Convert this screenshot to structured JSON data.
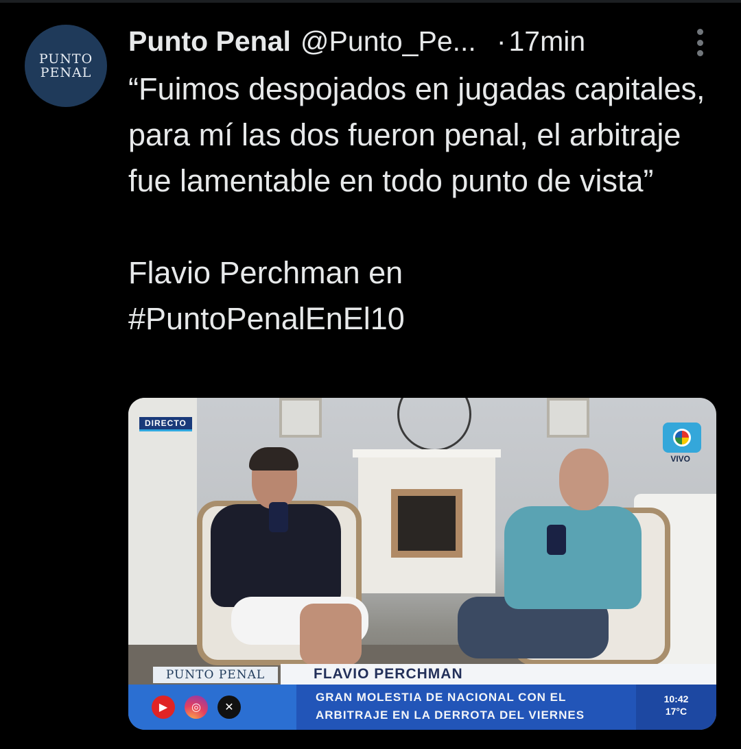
{
  "tweet": {
    "avatar_text_line1": "PUNTO",
    "avatar_text_line2": "PENAL",
    "display_name": "Punto Penal",
    "handle": "@Punto_Pe...",
    "separator": "·",
    "time": "17min",
    "text_quote": "“Fuimos despojados en jugadas capitales, para mí las dos fueron penal, el arbitraje fue lamentable en todo punto de vista”",
    "text_line2": "Flavio Perchman en",
    "hashtag": "#PuntoPenalEnEl10"
  },
  "media": {
    "live_tag": "DIRECTO",
    "channel_vivo": "VIVO",
    "lower_third": {
      "brand": "PUNTO PENAL",
      "name": "FLAVIO PERCHMAN",
      "headline_line1": "GRAN MOLESTIA DE NACIONAL CON EL",
      "headline_line2": "ARBITRAJE EN LA DERROTA DEL VIERNES",
      "clock_time": "10:42",
      "temperature": "17°C",
      "social_icons": [
        "youtube-icon",
        "instagram-icon",
        "x-icon"
      ]
    }
  },
  "colors": {
    "background": "#000000",
    "text": "#e7e9ea",
    "muted": "#71767b",
    "avatar_bg": "#1f3a5a",
    "lower_third_blue": "#2255b8"
  }
}
